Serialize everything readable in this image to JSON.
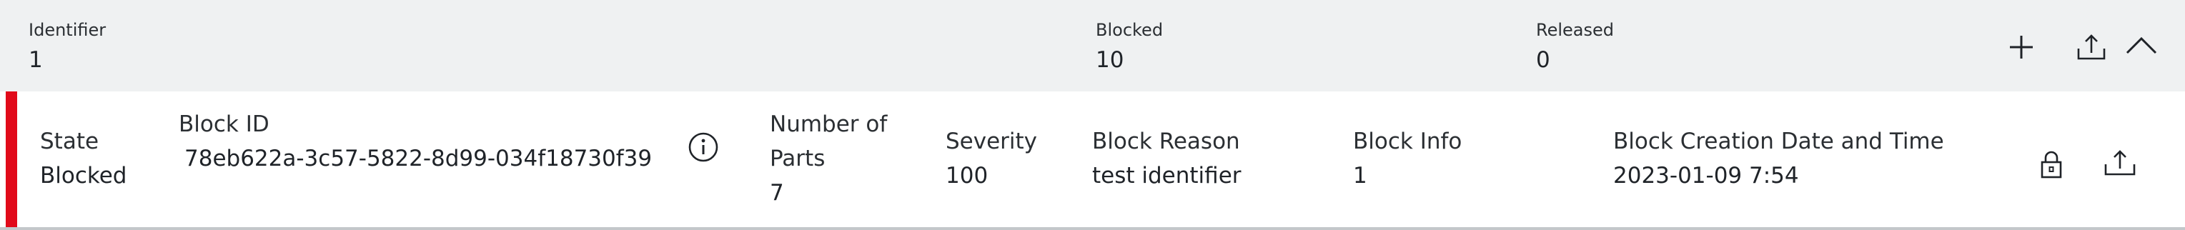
{
  "summary": {
    "identifier": {
      "label": "Identifier",
      "value": "1"
    },
    "blocked": {
      "label": "Blocked",
      "value": "10"
    },
    "released": {
      "label": "Released",
      "value": "0"
    },
    "actions": [
      {
        "icon": "plus-icon",
        "action": "add"
      },
      {
        "icon": "export-icon",
        "action": "export"
      },
      {
        "icon": "chevron-up-icon",
        "action": "collapse"
      }
    ]
  },
  "row": {
    "status_color": "#e10a1a",
    "state": {
      "label": "State",
      "value": "Blocked"
    },
    "block_id": {
      "label": "Block ID",
      "value": "78eb622a-3c57-5822-8d99-034f18730f39",
      "info_icon": "info-icon"
    },
    "parts": {
      "label_line1": "Number of",
      "label_line2": "Parts",
      "value": "7"
    },
    "severity": {
      "label": "Severity",
      "value": "100"
    },
    "block_reason": {
      "label": "Block Reason",
      "value": "test identifier"
    },
    "block_info": {
      "label": "Block Info",
      "value": "1"
    },
    "created": {
      "label": "Block Creation Date and Time",
      "value": "2023-01-09 7:54"
    },
    "actions": [
      {
        "icon": "lock-icon",
        "action": "lock"
      },
      {
        "icon": "export-icon",
        "action": "export"
      }
    ]
  }
}
